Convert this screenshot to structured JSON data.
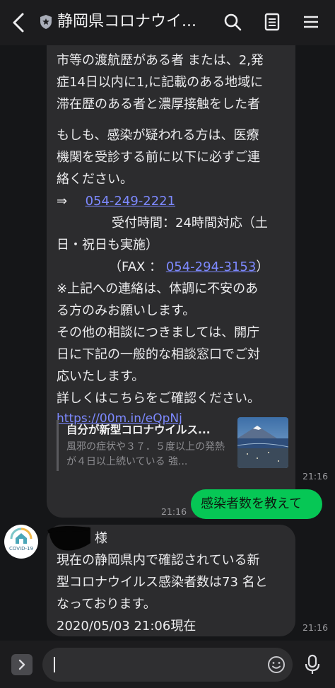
{
  "header": {
    "title": "静岡県コロナウイ...",
    "icons": [
      "back-icon",
      "shield-verified-icon",
      "search-icon",
      "notes-icon",
      "menu-icon"
    ]
  },
  "messages": {
    "msg1": {
      "lines": [
        "市等の渡航歴がある者 または、2,発",
        "症14日以内に1,に記載のある地域に",
        "滞在歴のある者と濃厚接触をした者",
        "",
        "もしも、感染が疑われる方は、医療",
        "機関を受診する前に以下に必ずご連",
        "絡ください。"
      ],
      "arrow": "⇒",
      "phone": "054-249-2221",
      "hours_line1": "受付時間：24時間対応（土",
      "hours_line2": "日・祝日も実施）",
      "fax_prefix": "（FAX ：",
      "fax_number": "054-294-3153",
      "fax_suffix": "）",
      "lines2": [
        "※上記への連絡は、体調に不安のあ",
        "る方のみお願いします。",
        "その他の相談につきましては、開庁",
        "日に下記の一般的な相談窓口でご対",
        "応いたします。",
        "詳しくはこちらをご確認ください。"
      ],
      "url": "https://00m.in/eQpNj",
      "preview": {
        "title": "自分が新型コロナウイルス...",
        "description": "風邪の症状や３７．５度以上の発熱が４日以上続いている 強..."
      },
      "time": "21:16"
    },
    "msg2": {
      "text": "感染者数を教えて",
      "time": "21:16"
    },
    "msg3": {
      "honorific": "様",
      "lines": [
        "現在の静岡県内で確認されている新",
        "型コロナウイルス感染者数は73 名と",
        "なっております。",
        "2020/05/03 21:06現在"
      ],
      "time": "21:16",
      "avatar_label": "COVID-19"
    }
  },
  "footer": {
    "input_value": "",
    "icons": [
      "expand-icon",
      "emoji-icon",
      "mic-icon"
    ]
  },
  "colors": {
    "background": "#151618",
    "bubble_incoming": "#2c2c2e",
    "bubble_outgoing": "#06c755",
    "link": "#7d89ff"
  }
}
